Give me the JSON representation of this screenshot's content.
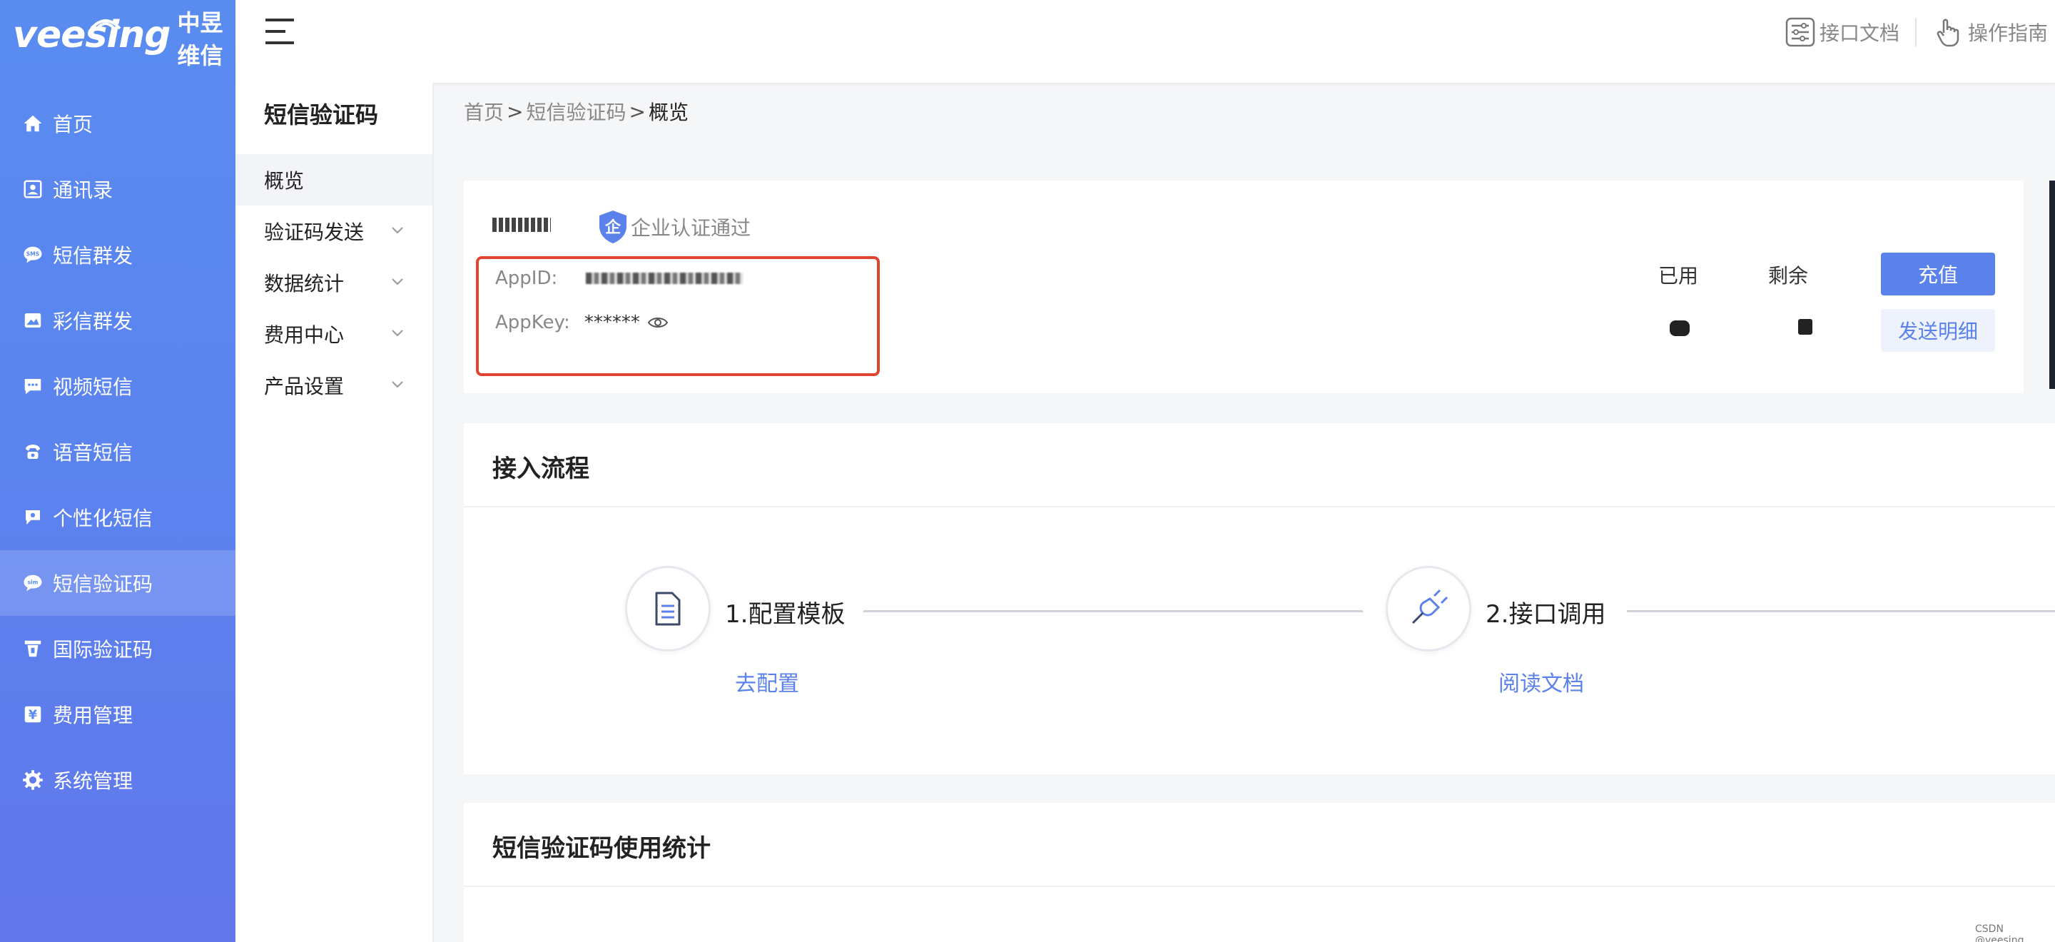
{
  "brand": {
    "word": "veesing",
    "cn": "中昱维信"
  },
  "nav": [
    {
      "label": "首页",
      "icon": "home-icon"
    },
    {
      "label": "通讯录",
      "icon": "contacts-icon"
    },
    {
      "label": "短信群发",
      "icon": "sms-icon"
    },
    {
      "label": "彩信群发",
      "icon": "image-icon"
    },
    {
      "label": "视频短信",
      "icon": "chat-dots-icon"
    },
    {
      "label": "语音短信",
      "icon": "phone-icon"
    },
    {
      "label": "个性化短信",
      "icon": "personal-icon"
    },
    {
      "label": "短信验证码",
      "icon": "sim-icon"
    },
    {
      "label": "国际验证码",
      "icon": "international-icon"
    },
    {
      "label": "费用管理",
      "icon": "yen-icon"
    },
    {
      "label": "系统管理",
      "icon": "gear-icon"
    }
  ],
  "nav_active_index": 7,
  "header": {
    "docs_label": "接口文档",
    "guide_label": "操作指南"
  },
  "subnav": {
    "title": "短信验证码",
    "items": [
      {
        "label": "概览"
      },
      {
        "label": "验证码发送"
      },
      {
        "label": "数据统计"
      },
      {
        "label": "费用中心"
      },
      {
        "label": "产品设置"
      }
    ]
  },
  "breadcrumb": {
    "home": "首页",
    "section": "短信验证码",
    "current": "概览",
    "sep": ">"
  },
  "account": {
    "verify_label": "企业认证通过",
    "appid_label": "AppID:",
    "appkey_label": "AppKey:",
    "appkey_value": "******",
    "used_label": "已用",
    "remaining_label": "剩余",
    "recharge_label": "充值",
    "detail_label": "发送明细"
  },
  "flow": {
    "title": "接入流程",
    "steps": [
      {
        "label": "1.配置模板",
        "link": "去配置",
        "icon": "document-icon"
      },
      {
        "label": "2.接口调用",
        "link": "阅读文档",
        "icon": "plug-icon"
      }
    ]
  },
  "stats": {
    "title": "短信验证码使用统计"
  },
  "watermark": "CSDN @veesing",
  "colors": {
    "sidebar": "#5a8cf0",
    "accent": "#5a82ea",
    "highlight_box": "#e0452f"
  }
}
